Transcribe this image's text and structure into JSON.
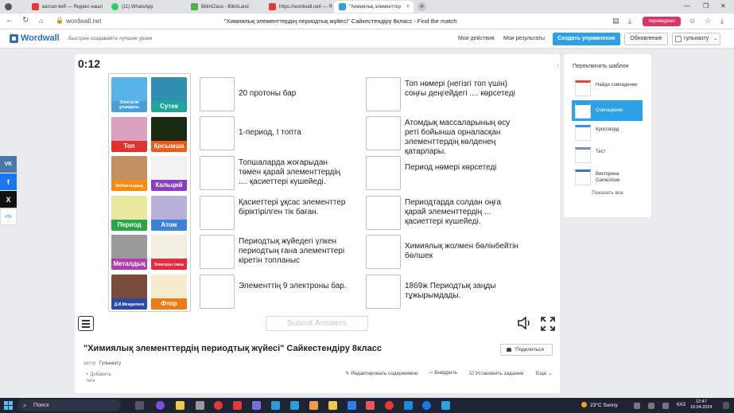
{
  "browser": {
    "tabs": [
      {
        "label": "ватсап веб — Яндекс нашл",
        "color": "#e53935"
      },
      {
        "label": "(11) WhatsApp",
        "color": "#25d366"
      },
      {
        "label": "BilimClass - BilimLand",
        "color": "#4caf50"
      },
      {
        "label": "https://wordwall.net/ — Я",
        "color": "#e53935"
      },
      {
        "label": "\"Химиялық элементтер",
        "color": "#2ea0e6"
      }
    ],
    "new_tab": "+",
    "url": "wordwall.net",
    "page_title": "\"Химиялық элементтердің периодтық жүйесі\" Сайкестендіру 8класс - Find the match",
    "translated_badge": "переведено"
  },
  "header": {
    "logo": "Wordwall",
    "tagline": "Быстрее создавайте лучшие уроки",
    "my_actions": "Мои действия",
    "my_results": "Мои результаты",
    "create": "Создать упражнение",
    "update": "Обновление",
    "user": "гульназту"
  },
  "social": {
    "vk": "VK",
    "fb": "f",
    "x": "X",
    "embed": "</>"
  },
  "game": {
    "timer": "0:12",
    "tiles": [
      {
        "label": "Электрлік ұғымдағы",
        "small": true,
        "color": "#4a9fd6",
        "art": "#58b4e8"
      },
      {
        "label": "Сутек",
        "small": false,
        "color": "#1ea59b",
        "art": "#2f8fb0"
      },
      {
        "label": "Топ",
        "small": false,
        "color": "#e0322d",
        "art": "#d9a0c0"
      },
      {
        "label": "Қосымша",
        "small": false,
        "color": "#ef5a14",
        "art": "#1a2a12"
      },
      {
        "label": "Бейметалдық",
        "small": true,
        "color": "#f58a15",
        "art": "#c09060"
      },
      {
        "label": "Кальций",
        "small": false,
        "color": "#8a3cc2",
        "art": "#f2f2f2"
      },
      {
        "label": "Период",
        "small": false,
        "color": "#2aa64a",
        "art": "#e8e8a0"
      },
      {
        "label": "Атом",
        "small": false,
        "color": "#3c82d9",
        "art": "#b8b0d8"
      },
      {
        "label": "Металдық",
        "small": false,
        "color": "#b53ab0",
        "art": "#9a9a9a"
      },
      {
        "label": "Электрон саны",
        "small": true,
        "color": "#e8283c",
        "art": "#f2efe0"
      },
      {
        "label": "Д.И.Менделеев",
        "small": true,
        "color": "#2a4aa8",
        "art": "#7a4a3a"
      },
      {
        "label": "Фтор",
        "small": false,
        "color": "#f07a12",
        "art": "#f8ecd0"
      }
    ],
    "definitions_left": [
      "20 протоны бар",
      "1-период, I топта",
      "Топшаларда жоғарыдан төмен қарай элементтердің .... қасиеттері күшейеді.",
      "Қасиеттері ұқсас элементтер біріктірілген тік баған.",
      "Периодтық жүйедегі үлкен периодтың ғана элементтері кіретін топланыс",
      "Элементтің 9 электроны бар."
    ],
    "definitions_right": [
      "Топ нөмері (негізгі топ үшін) соңғы деңгейдегі .... көрсетеді",
      "Атомдық массаларының өсу реті бойынша орналасқан элементтердің көлденең қатарлары.",
      "Период нөмері көрсетеді",
      "Периодтарда солдан оңға қарай элементтердің ... қасиеттері күшейеді.",
      "Химиялық жолмен бөлінбейтін бөлшек",
      "1869ж Периодтық заңды тұжырымдады."
    ],
    "submit": "Submit Answers"
  },
  "templates": {
    "title": "Переключить шаблон",
    "items": [
      {
        "label": "Найди совпадение",
        "selected": false
      },
      {
        "label": "Совпадение",
        "selected": true
      },
      {
        "label": "Кроссворд",
        "selected": false
      },
      {
        "label": "Тест",
        "selected": false
      },
      {
        "label": "Викторина Gameshow",
        "selected": false
      }
    ],
    "show_all": "Показать все"
  },
  "info": {
    "title": "\"Химиялық элементтердің периодтық жүйесі\" Сайкестендіру 8класс",
    "share": "Поделиться",
    "author_label": "автор",
    "author": "Гульназту",
    "add_tags": "Добавить теги",
    "edit": "Редактировать содержимое",
    "embed": "Внедрить",
    "assign": "Установить задание",
    "more": "Еще"
  },
  "taskbar": {
    "search": "Поиск",
    "weather": "23°C  Sunny",
    "lang": "КАЗ",
    "time": "12:47",
    "date": "19.04.2024"
  }
}
